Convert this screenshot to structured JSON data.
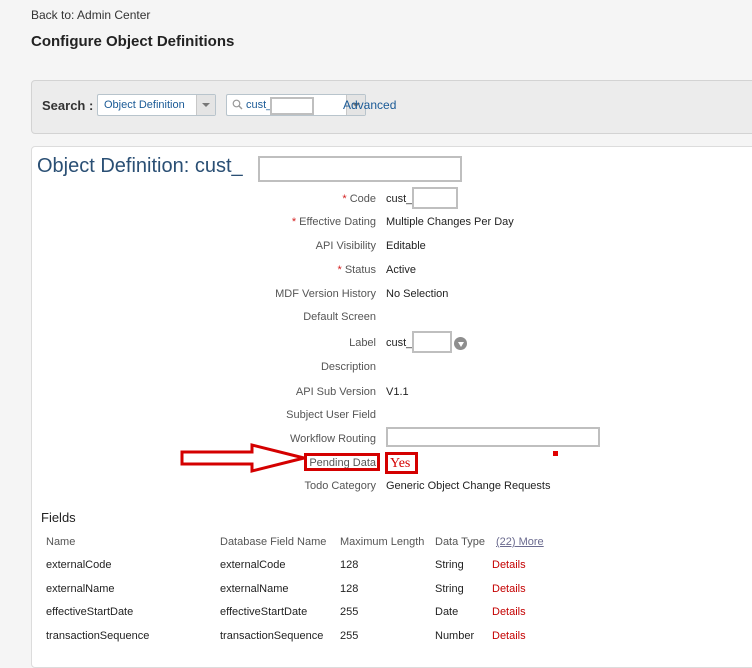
{
  "nav": {
    "back_link": "Back to: Admin Center"
  },
  "page": {
    "title": "Configure Object Definitions"
  },
  "search": {
    "label": "Search :",
    "type_value": "Object Definition",
    "query_value": "cust_",
    "advanced_label": "Advanced"
  },
  "object": {
    "title": "Object Definition: cust_",
    "fields": [
      {
        "label": "Code",
        "required": "*",
        "value": "cust_"
      },
      {
        "label": "Effective Dating",
        "required": "*",
        "value": "Multiple Changes Per Day"
      },
      {
        "label": "API Visibility",
        "value": "Editable"
      },
      {
        "label": "Status",
        "required": "*",
        "value": "Active"
      },
      {
        "label": "MDF Version History",
        "value": "No Selection"
      },
      {
        "label": "Default Screen",
        "value": ""
      },
      {
        "label": "Label",
        "value": "cust_"
      },
      {
        "label": "Description",
        "value": ""
      },
      {
        "label": "API Sub Version",
        "value": "V1.1"
      },
      {
        "label": "Subject User Field",
        "value": ""
      },
      {
        "label": "Workflow Routing",
        "value": ""
      },
      {
        "label": "Pending Data",
        "value": "Yes"
      },
      {
        "label": "Todo Category",
        "value": "Generic Object Change Requests"
      }
    ]
  },
  "fields_table": {
    "heading": "Fields",
    "columns": [
      "Name",
      "Database Field Name",
      "Maximum Length",
      "Data Type"
    ],
    "more_label": "(22) More",
    "details_label": "Details",
    "rows": [
      {
        "name": "externalCode",
        "db": "externalCode",
        "len": "128",
        "type": "String"
      },
      {
        "name": "externalName",
        "db": "externalName",
        "len": "128",
        "type": "String"
      },
      {
        "name": "effectiveStartDate",
        "db": "effectiveStartDate",
        "len": "255",
        "type": "Date"
      },
      {
        "name": "transactionSequence",
        "db": "transactionSequence",
        "len": "255",
        "type": "Number"
      }
    ]
  },
  "annotation": {
    "color": "#d40000"
  }
}
